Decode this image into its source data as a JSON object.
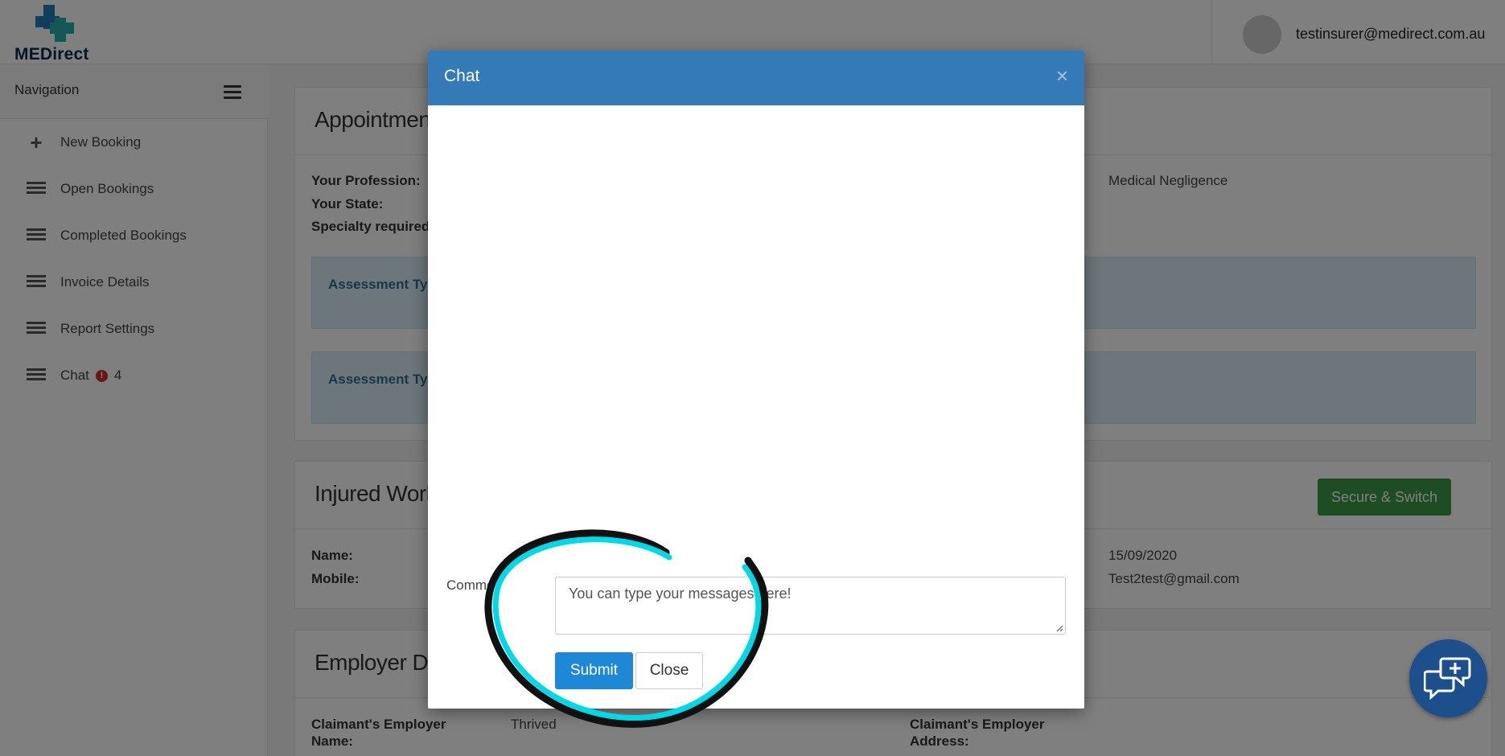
{
  "header": {
    "logo_text": "MEDirect",
    "user_email": "testinsurer@medirect.com.au"
  },
  "sidebar": {
    "title": "Navigation",
    "items": [
      {
        "label": "New Booking",
        "icon": "plus-icon"
      },
      {
        "label": "Open Bookings",
        "icon": "list-icon"
      },
      {
        "label": "Completed Bookings",
        "icon": "list-icon"
      },
      {
        "label": "Invoice Details",
        "icon": "list-icon"
      },
      {
        "label": "Report Settings",
        "icon": "list-icon"
      },
      {
        "label": "Chat",
        "icon": "list-icon",
        "alert": "!",
        "count": "4"
      }
    ]
  },
  "appointment": {
    "title": "Appointment",
    "profession_label": "Your Profession:",
    "state_label": "Your State:",
    "specialty_label": "Specialty required:",
    "right_value": "Medical Negligence",
    "assessment_1": "Assessment Typ",
    "assessment_2": "Assessment Typ"
  },
  "injured": {
    "title": "Injured Worke",
    "name_label": "Name:",
    "mobile_label": "Mobile:",
    "date_value": "15/09/2020",
    "email_value": "Test2test@gmail.com",
    "action_label": "Secure & Switch"
  },
  "employer": {
    "title": "Employer Det",
    "name_label_1": "Claimant's Employer",
    "name_label_2": "Name:",
    "name_value": "Thrived",
    "address_label_1": "Claimant's Employer",
    "address_label_2": "Address:"
  },
  "modal": {
    "title": "Chat",
    "close_x": "×",
    "comment_label": "Comme",
    "comment_placeholder": "You can type your messages here!",
    "submit_label": "Submit",
    "close_label": "Close"
  },
  "colors": {
    "modal_header": "#337ab7",
    "submit": "#1e87d6",
    "annotation": "#00d8e8",
    "fab": "#1d4f8c"
  }
}
